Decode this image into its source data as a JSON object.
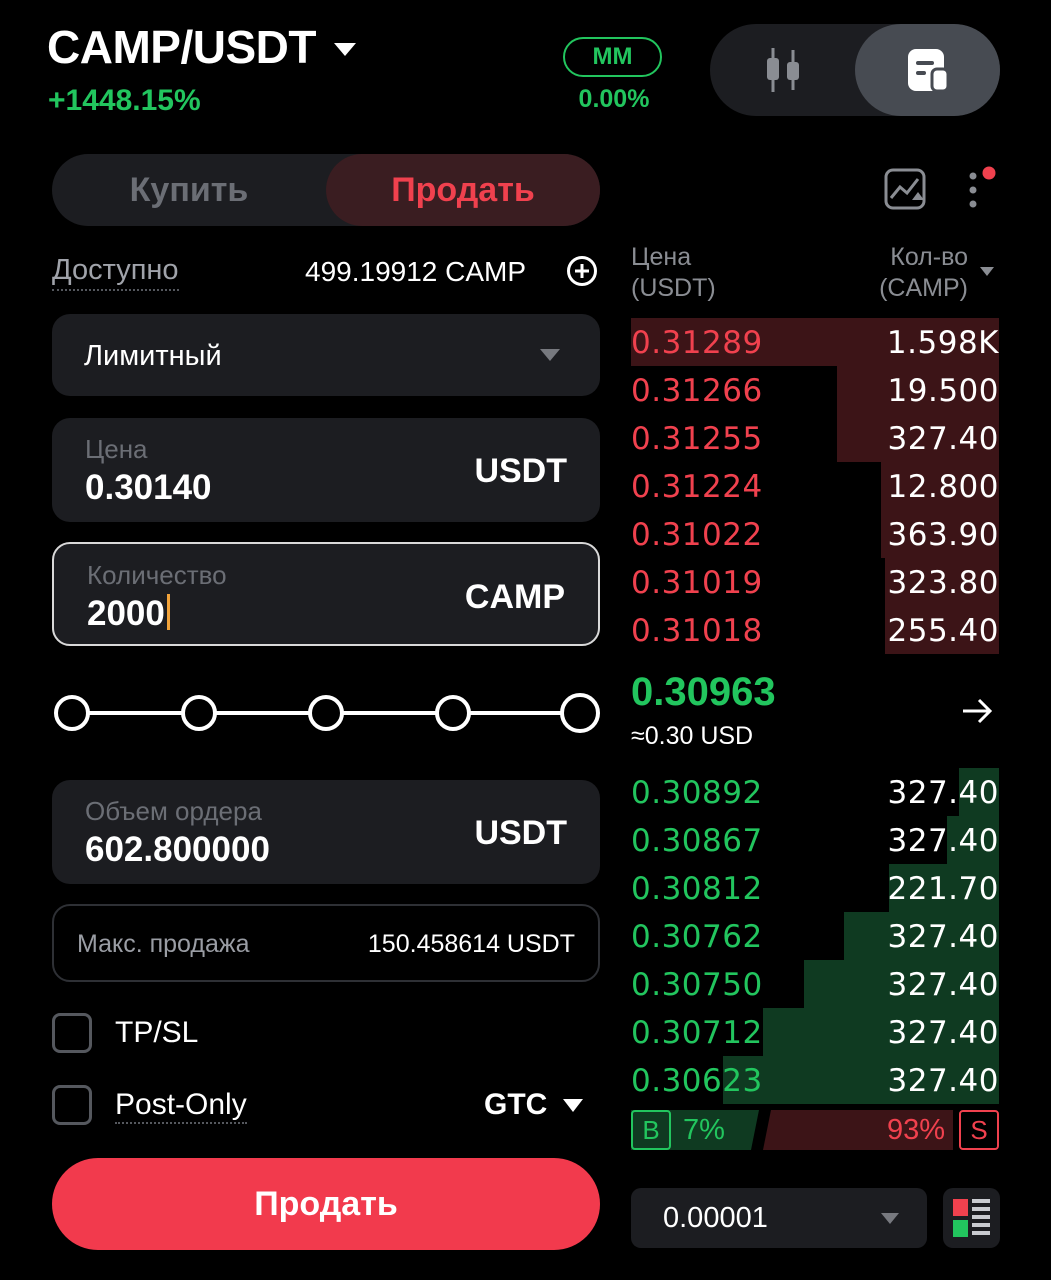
{
  "header": {
    "pair": "CAMP/USDT",
    "change": "+1448.15%",
    "mm_label": "MM",
    "mm_value": "0.00%"
  },
  "tabs": {
    "buy": "Купить",
    "sell": "Продать",
    "active": "sell"
  },
  "available": {
    "label": "Доступно",
    "value": "499.19912 CAMP"
  },
  "order_type": {
    "value": "Лимитный"
  },
  "price": {
    "label": "Цена",
    "value": "0.30140",
    "unit": "USDT"
  },
  "quantity": {
    "label": "Количество",
    "value": "2000",
    "unit": "CAMP"
  },
  "order_volume": {
    "label": "Объем ордера",
    "value": "602.800000",
    "unit": "USDT"
  },
  "max_sell": {
    "label": "Макс. продажа",
    "value": "150.458614 USDT"
  },
  "options": {
    "tpsl": "TP/SL",
    "post_only": "Post-Only",
    "tif": "GTC"
  },
  "submit": {
    "label": "Продать"
  },
  "orderbook": {
    "price_header": "Цена",
    "price_unit": "(USDT)",
    "qty_header": "Кол-во",
    "qty_unit": "(CAMP)",
    "asks": [
      {
        "price": "0.31289",
        "qty": "1.598K",
        "depth": 1.0
      },
      {
        "price": "0.31266",
        "qty": "19.500",
        "depth": 0.44
      },
      {
        "price": "0.31255",
        "qty": "327.40",
        "depth": 0.44
      },
      {
        "price": "0.31224",
        "qty": "12.800",
        "depth": 0.32
      },
      {
        "price": "0.31022",
        "qty": "363.90",
        "depth": 0.32
      },
      {
        "price": "0.31019",
        "qty": "323.80",
        "depth": 0.31
      },
      {
        "price": "0.31018",
        "qty": "255.40",
        "depth": 0.31
      }
    ],
    "last_price": "0.30963",
    "last_usd": "≈0.30 USD",
    "bids": [
      {
        "price": "0.30892",
        "qty": "327.40",
        "depth": 0.11
      },
      {
        "price": "0.30867",
        "qty": "327.40",
        "depth": 0.14
      },
      {
        "price": "0.30812",
        "qty": "221.70",
        "depth": 0.3
      },
      {
        "price": "0.30762",
        "qty": "327.40",
        "depth": 0.42
      },
      {
        "price": "0.30750",
        "qty": "327.40",
        "depth": 0.53
      },
      {
        "price": "0.30712",
        "qty": "327.40",
        "depth": 0.64
      },
      {
        "price": "0.30623",
        "qty": "327.40",
        "depth": 0.75
      }
    ],
    "buy_label": "B",
    "buy_pct": "7%",
    "sell_pct": "93%",
    "sell_label": "S",
    "tick_size": "0.00001"
  },
  "colors": {
    "green": "#22c55e",
    "red": "#f0414e",
    "sell_button": "#f23a4d"
  },
  "icons": [
    "candlestick-icon",
    "orderbook-view-icon",
    "plus-circle-icon",
    "chart-icon",
    "more-icon",
    "arrow-right-icon",
    "layout-icon"
  ]
}
